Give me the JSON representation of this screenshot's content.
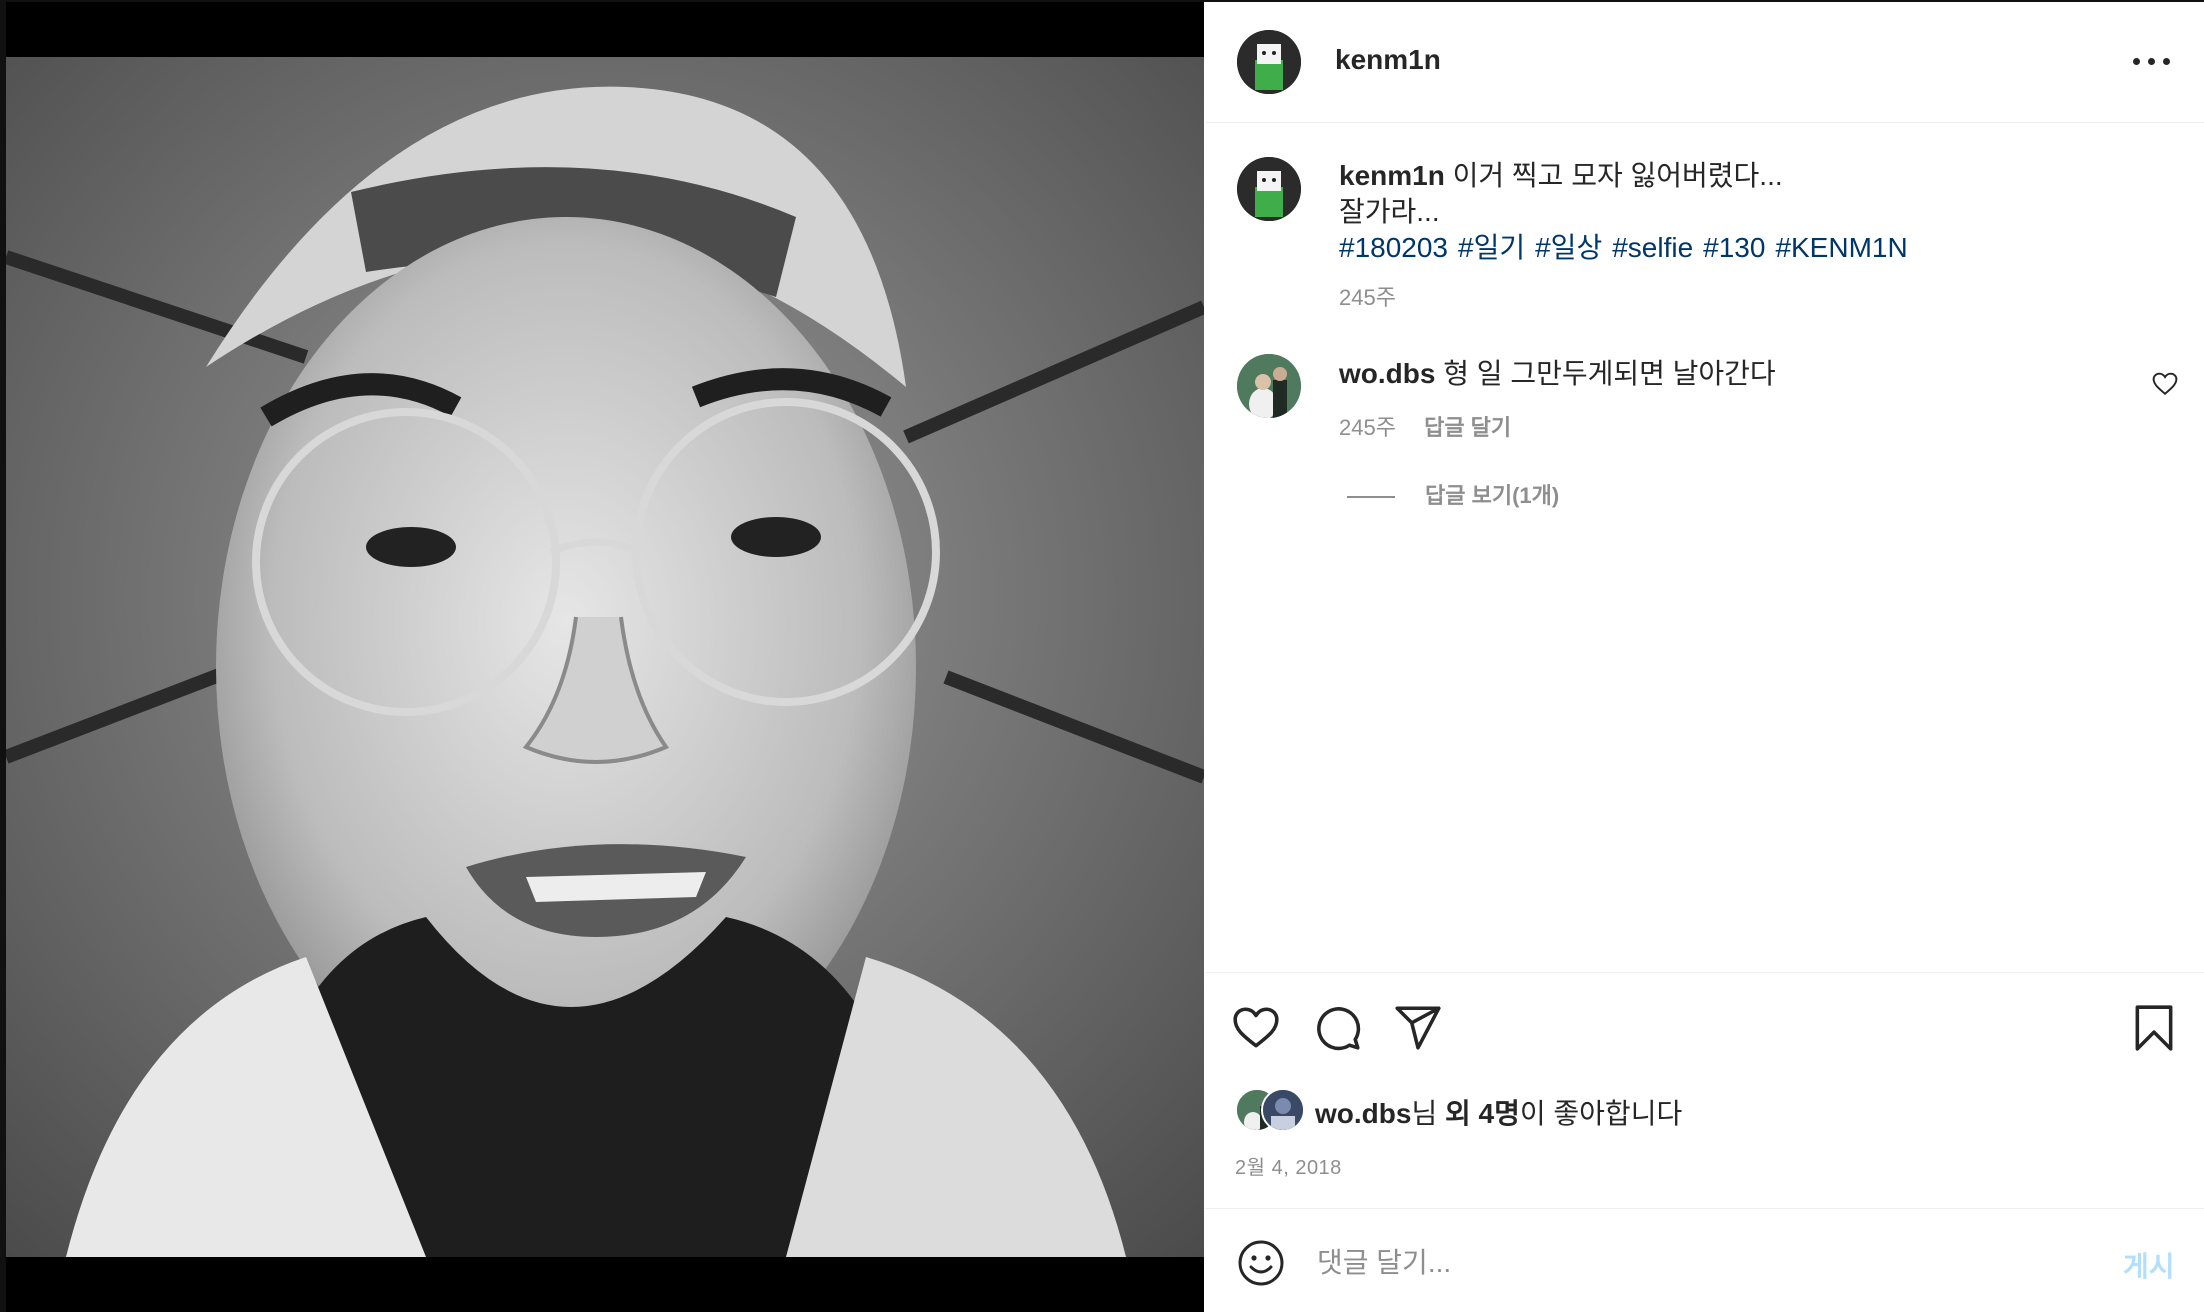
{
  "post": {
    "author": "kenm1n",
    "caption_line1": "이거 찍고 모자 잃어버렸다...",
    "caption_line2": "잘가라...",
    "hashtags": [
      "#180203",
      "#일기",
      "#일상",
      "#selfie",
      "#130",
      "#KENM1N"
    ],
    "caption_time": "245주",
    "comments": [
      {
        "username": "wo.dbs",
        "text": "형 일 그만두게되면 날아간다",
        "time": "245주",
        "reply_label": "답글 달기",
        "view_replies_label": "답글 보기(1개)"
      }
    ],
    "likes": {
      "first_user": "wo.dbs",
      "suffix1": "님 ",
      "others_label": "외 4명",
      "suffix2": "이 좋아합니다"
    },
    "date": "2월 4, 2018"
  },
  "add_comment": {
    "placeholder": "댓글 달기...",
    "post_label": "게시"
  },
  "icons": {
    "more": "more-options-icon",
    "like": "heart-icon",
    "comment": "comment-bubble-icon",
    "share": "paper-plane-icon",
    "save": "bookmark-icon",
    "emoji": "smiley-face-icon"
  },
  "colors": {
    "hashtag": "#00376b",
    "meta_gray": "#8e8e8e",
    "post_button_disabled": "#b2dffc"
  }
}
